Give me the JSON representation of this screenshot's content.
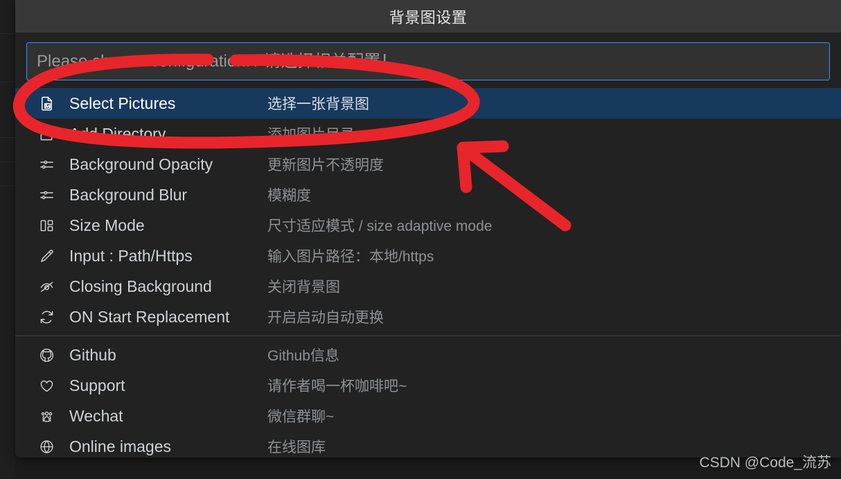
{
  "dialog": {
    "title": "背景图设置",
    "input": {
      "value": "",
      "placeholder": "Please choose configuration! / 请选择相关配置！"
    }
  },
  "menu": {
    "items": [
      {
        "icon": "file-image-icon",
        "label": "Select Pictures",
        "description": "选择一张背景图",
        "selected": true,
        "separator_after": false
      },
      {
        "icon": "folder-icon",
        "label": "Add Directory",
        "description": "添加图片目录",
        "selected": false,
        "separator_after": false
      },
      {
        "icon": "sliders-icon",
        "label": "Background Opacity",
        "description": "更新图片不透明度",
        "selected": false,
        "separator_after": false
      },
      {
        "icon": "sliders-icon",
        "label": "Background Blur",
        "description": "模糊度",
        "selected": false,
        "separator_after": false
      },
      {
        "icon": "layout-split-icon",
        "label": "Size Mode",
        "description": "尺寸适应模式 / size adaptive mode",
        "selected": false,
        "separator_after": false
      },
      {
        "icon": "pencil-icon",
        "label": "Input : Path/Https",
        "description": "输入图片路径：本地/https",
        "selected": false,
        "separator_after": false
      },
      {
        "icon": "eye-off-icon",
        "label": "Closing Background",
        "description": "关闭背景图",
        "selected": false,
        "separator_after": false
      },
      {
        "icon": "refresh-icon",
        "label": "ON Start Replacement",
        "description": "开启启动自动更换",
        "selected": false,
        "separator_after": true
      },
      {
        "icon": "github-icon",
        "label": "Github",
        "description": "Github信息",
        "selected": false,
        "separator_after": false
      },
      {
        "icon": "heart-icon",
        "label": "Support",
        "description": "请作者喝一杯咖啡吧~",
        "selected": false,
        "separator_after": false
      },
      {
        "icon": "people-group-icon",
        "label": "Wechat",
        "description": "微信群聊~",
        "selected": false,
        "separator_after": false
      },
      {
        "icon": "globe-icon",
        "label": "Online images",
        "description": "在线图库",
        "selected": false,
        "separator_after": false
      }
    ]
  },
  "annotation": {
    "color": "#e8252a",
    "shapes": [
      "ellipse-highlight",
      "arrow-pointer"
    ]
  },
  "watermark": {
    "text": "CSDN @Code_流苏"
  },
  "colors": {
    "titlebar": "#383838",
    "dialog_body": "#222222",
    "selected_row": "#17395e",
    "input_border": "#3794ff",
    "annotation_red": "#e8252a"
  }
}
